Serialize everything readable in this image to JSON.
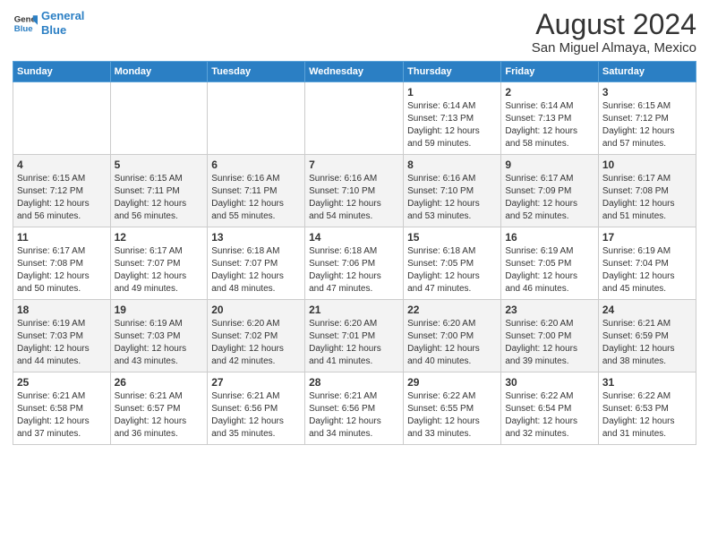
{
  "header": {
    "logo_line1": "General",
    "logo_line2": "Blue",
    "title": "August 2024",
    "subtitle": "San Miguel Almaya, Mexico"
  },
  "days_of_week": [
    "Sunday",
    "Monday",
    "Tuesday",
    "Wednesday",
    "Thursday",
    "Friday",
    "Saturday"
  ],
  "weeks": [
    [
      {
        "num": "",
        "info": ""
      },
      {
        "num": "",
        "info": ""
      },
      {
        "num": "",
        "info": ""
      },
      {
        "num": "",
        "info": ""
      },
      {
        "num": "1",
        "info": "Sunrise: 6:14 AM\nSunset: 7:13 PM\nDaylight: 12 hours\nand 59 minutes."
      },
      {
        "num": "2",
        "info": "Sunrise: 6:14 AM\nSunset: 7:13 PM\nDaylight: 12 hours\nand 58 minutes."
      },
      {
        "num": "3",
        "info": "Sunrise: 6:15 AM\nSunset: 7:12 PM\nDaylight: 12 hours\nand 57 minutes."
      }
    ],
    [
      {
        "num": "4",
        "info": "Sunrise: 6:15 AM\nSunset: 7:12 PM\nDaylight: 12 hours\nand 56 minutes."
      },
      {
        "num": "5",
        "info": "Sunrise: 6:15 AM\nSunset: 7:11 PM\nDaylight: 12 hours\nand 56 minutes."
      },
      {
        "num": "6",
        "info": "Sunrise: 6:16 AM\nSunset: 7:11 PM\nDaylight: 12 hours\nand 55 minutes."
      },
      {
        "num": "7",
        "info": "Sunrise: 6:16 AM\nSunset: 7:10 PM\nDaylight: 12 hours\nand 54 minutes."
      },
      {
        "num": "8",
        "info": "Sunrise: 6:16 AM\nSunset: 7:10 PM\nDaylight: 12 hours\nand 53 minutes."
      },
      {
        "num": "9",
        "info": "Sunrise: 6:17 AM\nSunset: 7:09 PM\nDaylight: 12 hours\nand 52 minutes."
      },
      {
        "num": "10",
        "info": "Sunrise: 6:17 AM\nSunset: 7:08 PM\nDaylight: 12 hours\nand 51 minutes."
      }
    ],
    [
      {
        "num": "11",
        "info": "Sunrise: 6:17 AM\nSunset: 7:08 PM\nDaylight: 12 hours\nand 50 minutes."
      },
      {
        "num": "12",
        "info": "Sunrise: 6:17 AM\nSunset: 7:07 PM\nDaylight: 12 hours\nand 49 minutes."
      },
      {
        "num": "13",
        "info": "Sunrise: 6:18 AM\nSunset: 7:07 PM\nDaylight: 12 hours\nand 48 minutes."
      },
      {
        "num": "14",
        "info": "Sunrise: 6:18 AM\nSunset: 7:06 PM\nDaylight: 12 hours\nand 47 minutes."
      },
      {
        "num": "15",
        "info": "Sunrise: 6:18 AM\nSunset: 7:05 PM\nDaylight: 12 hours\nand 47 minutes."
      },
      {
        "num": "16",
        "info": "Sunrise: 6:19 AM\nSunset: 7:05 PM\nDaylight: 12 hours\nand 46 minutes."
      },
      {
        "num": "17",
        "info": "Sunrise: 6:19 AM\nSunset: 7:04 PM\nDaylight: 12 hours\nand 45 minutes."
      }
    ],
    [
      {
        "num": "18",
        "info": "Sunrise: 6:19 AM\nSunset: 7:03 PM\nDaylight: 12 hours\nand 44 minutes."
      },
      {
        "num": "19",
        "info": "Sunrise: 6:19 AM\nSunset: 7:03 PM\nDaylight: 12 hours\nand 43 minutes."
      },
      {
        "num": "20",
        "info": "Sunrise: 6:20 AM\nSunset: 7:02 PM\nDaylight: 12 hours\nand 42 minutes."
      },
      {
        "num": "21",
        "info": "Sunrise: 6:20 AM\nSunset: 7:01 PM\nDaylight: 12 hours\nand 41 minutes."
      },
      {
        "num": "22",
        "info": "Sunrise: 6:20 AM\nSunset: 7:00 PM\nDaylight: 12 hours\nand 40 minutes."
      },
      {
        "num": "23",
        "info": "Sunrise: 6:20 AM\nSunset: 7:00 PM\nDaylight: 12 hours\nand 39 minutes."
      },
      {
        "num": "24",
        "info": "Sunrise: 6:21 AM\nSunset: 6:59 PM\nDaylight: 12 hours\nand 38 minutes."
      }
    ],
    [
      {
        "num": "25",
        "info": "Sunrise: 6:21 AM\nSunset: 6:58 PM\nDaylight: 12 hours\nand 37 minutes."
      },
      {
        "num": "26",
        "info": "Sunrise: 6:21 AM\nSunset: 6:57 PM\nDaylight: 12 hours\nand 36 minutes."
      },
      {
        "num": "27",
        "info": "Sunrise: 6:21 AM\nSunset: 6:56 PM\nDaylight: 12 hours\nand 35 minutes."
      },
      {
        "num": "28",
        "info": "Sunrise: 6:21 AM\nSunset: 6:56 PM\nDaylight: 12 hours\nand 34 minutes."
      },
      {
        "num": "29",
        "info": "Sunrise: 6:22 AM\nSunset: 6:55 PM\nDaylight: 12 hours\nand 33 minutes."
      },
      {
        "num": "30",
        "info": "Sunrise: 6:22 AM\nSunset: 6:54 PM\nDaylight: 12 hours\nand 32 minutes."
      },
      {
        "num": "31",
        "info": "Sunrise: 6:22 AM\nSunset: 6:53 PM\nDaylight: 12 hours\nand 31 minutes."
      }
    ]
  ]
}
